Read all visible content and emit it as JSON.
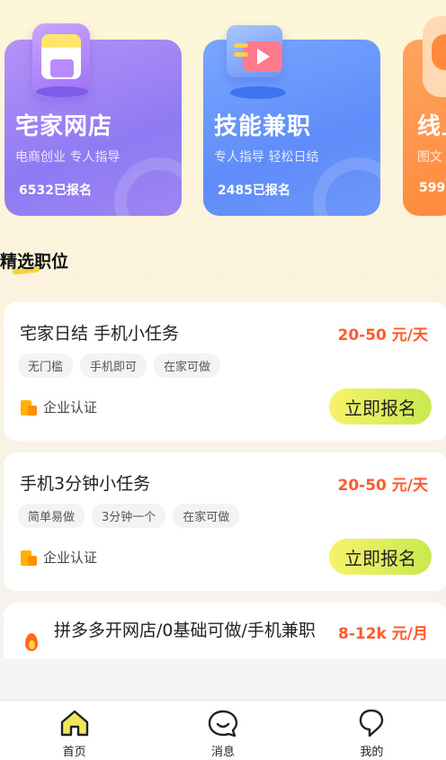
{
  "categories": [
    {
      "title": "宅家网店",
      "subtitle": "电商创业 专人指导",
      "count": "6532已报名",
      "icon": "shopping-phone-icon"
    },
    {
      "title": "技能兼职",
      "subtitle": "专人指导 轻松日结",
      "count": "2485已报名",
      "icon": "video-play-icon"
    },
    {
      "title": "线上",
      "subtitle": "图文",
      "count": "599",
      "icon": "orange-icon"
    }
  ],
  "section": {
    "title": "精选职位"
  },
  "jobs": [
    {
      "title": "宅家日结 手机小任务",
      "salary": "20-50 元/天",
      "tags": [
        "无门槛",
        "手机即可",
        "在家可做"
      ],
      "verify": "企业认证",
      "apply": "立即报名"
    },
    {
      "title": "手机3分钟小任务",
      "salary": "20-50 元/天",
      "tags": [
        "简单易做",
        "3分钟一个",
        "在家可做"
      ],
      "verify": "企业认证",
      "apply": "立即报名"
    },
    {
      "title": "拼多多开网店/0基础可做/手机兼职",
      "salary": "8-12k 元/月"
    }
  ],
  "nav": [
    {
      "label": "首页",
      "icon": "home-icon",
      "active": true
    },
    {
      "label": "消息",
      "icon": "message-icon",
      "active": false
    },
    {
      "label": "我的",
      "icon": "profile-icon",
      "active": false
    }
  ],
  "colors": {
    "accent": "#ff5a2b",
    "button": "#e8ee5a",
    "card_purple": "#9a80f4",
    "card_blue": "#6692fa",
    "card_orange": "#ff8f45"
  }
}
